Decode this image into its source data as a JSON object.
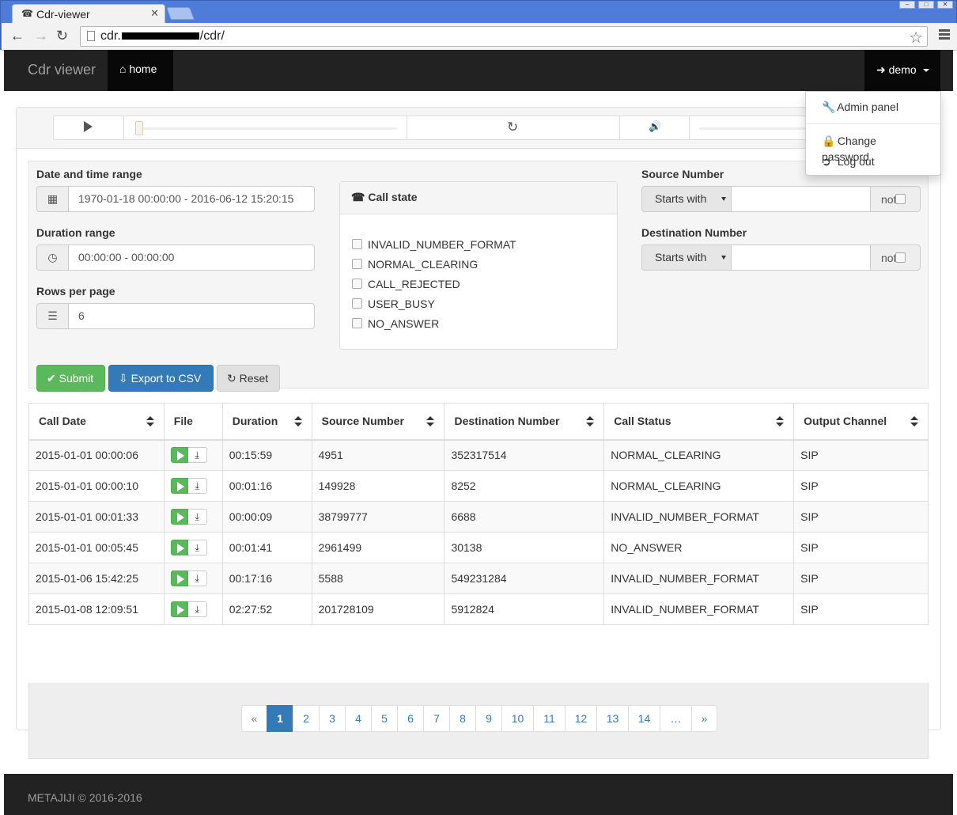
{
  "browser": {
    "tab_title": "Cdr-viewer",
    "url_prefix": "cdr.",
    "url_suffix": "/cdr/"
  },
  "navbar": {
    "brand": "Cdr viewer",
    "home_label": "home",
    "user_label": "demo"
  },
  "user_menu": {
    "items": [
      {
        "label": "Admin panel",
        "icon": "wrench-icon"
      },
      {
        "label": "Change password",
        "icon": "lock-icon"
      },
      {
        "label": "Log out",
        "icon": "logout-icon"
      }
    ]
  },
  "filters": {
    "date_label": "Date and time range",
    "date_value": "1970-01-18 00:00:00 - 2016-06-12 15:20:15",
    "duration_label": "Duration range",
    "duration_value": "00:00:00 - 00:00:00",
    "rows_label": "Rows per page",
    "rows_value": "6",
    "call_state_title": "Call state",
    "call_states": [
      "INVALID_NUMBER_FORMAT",
      "NORMAL_CLEARING",
      "CALL_REJECTED",
      "USER_BUSY",
      "NO_ANSWER"
    ],
    "source_label": "Source Number",
    "source_mode": "Starts with",
    "source_not": "not",
    "dest_label": "Destination Number",
    "dest_mode": "Starts with",
    "dest_not": "not"
  },
  "buttons": {
    "submit": "Submit",
    "export": "Export to CSV",
    "reset": "Reset"
  },
  "table": {
    "headers": [
      "Call Date",
      "File",
      "Duration",
      "Source Number",
      "Destination Number",
      "Call Status",
      "Output Channel"
    ],
    "rows": [
      {
        "date": "2015-01-01 00:00:06",
        "duration": "00:15:59",
        "source": "4951",
        "dest": "352317514",
        "status": "NORMAL_CLEARING",
        "channel": "SIP"
      },
      {
        "date": "2015-01-01 00:00:10",
        "duration": "00:01:16",
        "source": "149928",
        "dest": "8252",
        "status": "NORMAL_CLEARING",
        "channel": "SIP"
      },
      {
        "date": "2015-01-01 00:01:33",
        "duration": "00:00:09",
        "source": "38799777",
        "dest": "6688",
        "status": "INVALID_NUMBER_FORMAT",
        "channel": "SIP"
      },
      {
        "date": "2015-01-01 00:05:45",
        "duration": "00:01:41",
        "source": "2961499",
        "dest": "30138",
        "status": "NO_ANSWER",
        "channel": "SIP"
      },
      {
        "date": "2015-01-06 15:42:25",
        "duration": "00:17:16",
        "source": "5588",
        "dest": "549231284",
        "status": "INVALID_NUMBER_FORMAT",
        "channel": "SIP"
      },
      {
        "date": "2015-01-08 12:09:51",
        "duration": "02:27:52",
        "source": "201728109",
        "dest": "5912824",
        "status": "INVALID_NUMBER_FORMAT",
        "channel": "SIP"
      }
    ]
  },
  "pagination": {
    "prev": "«",
    "pages": [
      "1",
      "2",
      "3",
      "4",
      "5",
      "6",
      "7",
      "8",
      "9",
      "10",
      "11",
      "12",
      "13",
      "14",
      "…"
    ],
    "next": "»",
    "active": "1"
  },
  "footer": {
    "text": "METAJIJI © 2016-2016"
  },
  "colors": {
    "success": "#5cb85c",
    "primary": "#337ab7",
    "navbar": "#222222"
  }
}
